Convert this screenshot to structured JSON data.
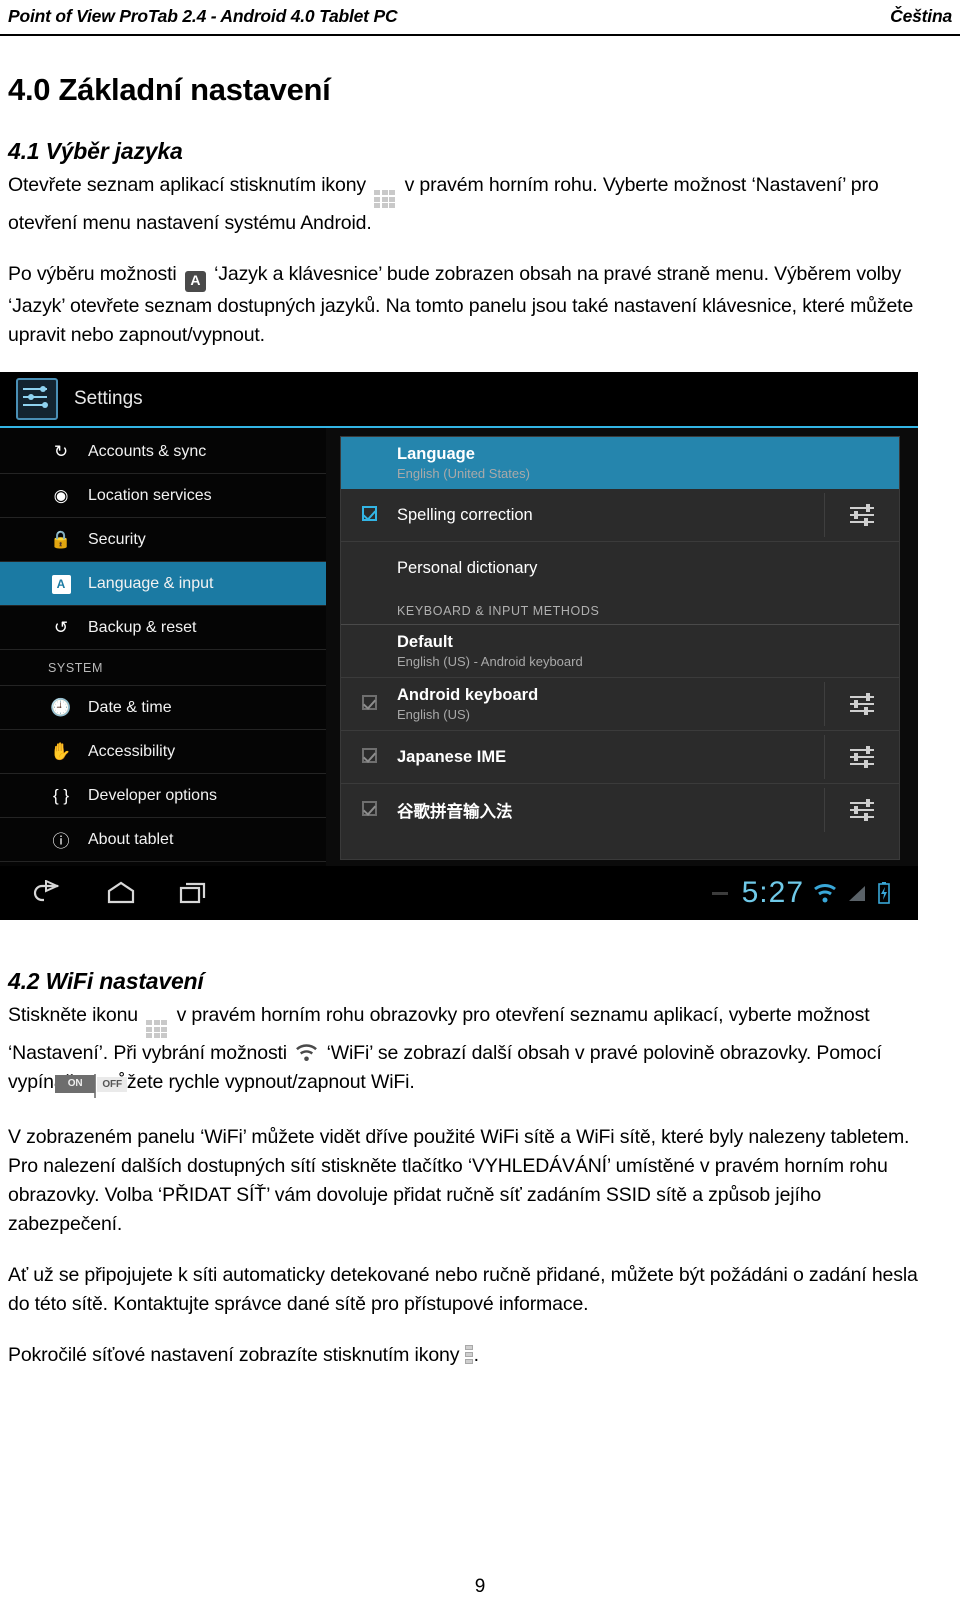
{
  "header": {
    "left": "Point of View ProTab 2.4 - Android 4.0 Tablet PC",
    "right": "Čeština"
  },
  "section": {
    "title": "4.0 Základní nastavení",
    "sub1_title": "4.1 Výběr jazyka",
    "p1_a": "Otevřete seznam aplikací stisknutím ikony",
    "p1_b": "v pravém horním rohu. Vyberte možnost ‘Nastavení’ pro otevření menu nastavení systému Android.",
    "p2_a": "Po výběru možnosti",
    "p2_b": "‘Jazyk a klávesnice’ bude zobrazen obsah na pravé straně menu. Výběrem volby ‘Jazyk’ otevřete seznam dostupných jazyků. Na tomto panelu jsou také nastavení klávesnice, které můžete upravit nebo zapnout/vypnout.",
    "sub2_title": "4.2 WiFi nastavení",
    "p3_a": "Stiskněte ikonu",
    "p3_b": "v pravém horním rohu obrazovky pro otevření seznamu aplikací, vyberte možnost ‘Nastavení’. Při vybrání možnosti",
    "p3_c": "‘WiFi’ se zobrazí další obsah v pravé polovině obrazovky. Pomocí vypínače",
    "p3_d": "můžete rychle vypnout/zapnout WiFi.",
    "p4": "V zobrazeném panelu ‘WiFi’ můžete vidět dříve použité WiFi sítě a WiFi sítě, které byly nalezeny tabletem. Pro nalezení dalších dostupných sítí stiskněte tlačítko ‘VYHLEDÁVÁNÍ’ umístěné v pravém horním rohu obrazovky. Volba ‘PŘIDAT SÍŤ’ vám dovoluje přidat ručně síť zadáním SSID sítě a způsob jejího zabezpečení.",
    "p5": "Ať už se připojujete k síti automaticky detekované nebo ručně přidané, můžete být požádáni o zadání hesla do této sítě. Kontaktujte správce dané sítě pro přístupové informace.",
    "p6_a": "Pokročilé síťové nastavení zobrazíte stisknutím ikony",
    "p6_b": "."
  },
  "inline_icons": {
    "apps_grid": "apps-grid-icon",
    "language_badge": "language-input-icon",
    "wifi": "wifi-icon",
    "toggle_off": "OFF",
    "toggle_on": "ON",
    "overflow": "overflow-menu-icon"
  },
  "android": {
    "app_title": "Settings",
    "sidebar": [
      {
        "label": "Accounts & sync",
        "icon": "sync-icon",
        "selected": false
      },
      {
        "label": "Location services",
        "icon": "location-icon",
        "selected": false
      },
      {
        "label": "Security",
        "icon": "lock-icon",
        "selected": false
      },
      {
        "label": "Language & input",
        "icon": "language-icon",
        "selected": true
      },
      {
        "label": "Backup & reset",
        "icon": "backup-icon",
        "selected": false
      }
    ],
    "sidebar_group_label": "SYSTEM",
    "sidebar_system": [
      {
        "label": "Date & time",
        "icon": "clock-icon"
      },
      {
        "label": "Accessibility",
        "icon": "hand-icon"
      },
      {
        "label": "Developer options",
        "icon": "braces-icon"
      },
      {
        "label": "About tablet",
        "icon": "info-icon"
      }
    ],
    "panel": {
      "language_title": "Language",
      "language_value": "English (United States)",
      "spelling_title": "Spelling correction",
      "spelling_checked": true,
      "personal_dictionary": "Personal dictionary",
      "section_label": "KEYBOARD & INPUT METHODS",
      "default_title": "Default",
      "default_value": "English (US) - Android keyboard",
      "methods": [
        {
          "title": "Android keyboard",
          "sub": "English (US)",
          "checked": true
        },
        {
          "title": "Japanese IME",
          "sub": "",
          "checked": true
        },
        {
          "title": "谷歌拼音输入法",
          "sub": "",
          "checked": true
        }
      ]
    },
    "navbar": {
      "back": "back-icon",
      "home": "home-icon",
      "recents": "recents-icon",
      "clock": "5:27",
      "wifi": "wifi-status-icon",
      "signal": "signal-icon",
      "battery": "battery-icon"
    },
    "accent_color": "#33b5e5",
    "highlight_color": "#1b7aa3"
  },
  "footer": {
    "page_number": "9"
  }
}
